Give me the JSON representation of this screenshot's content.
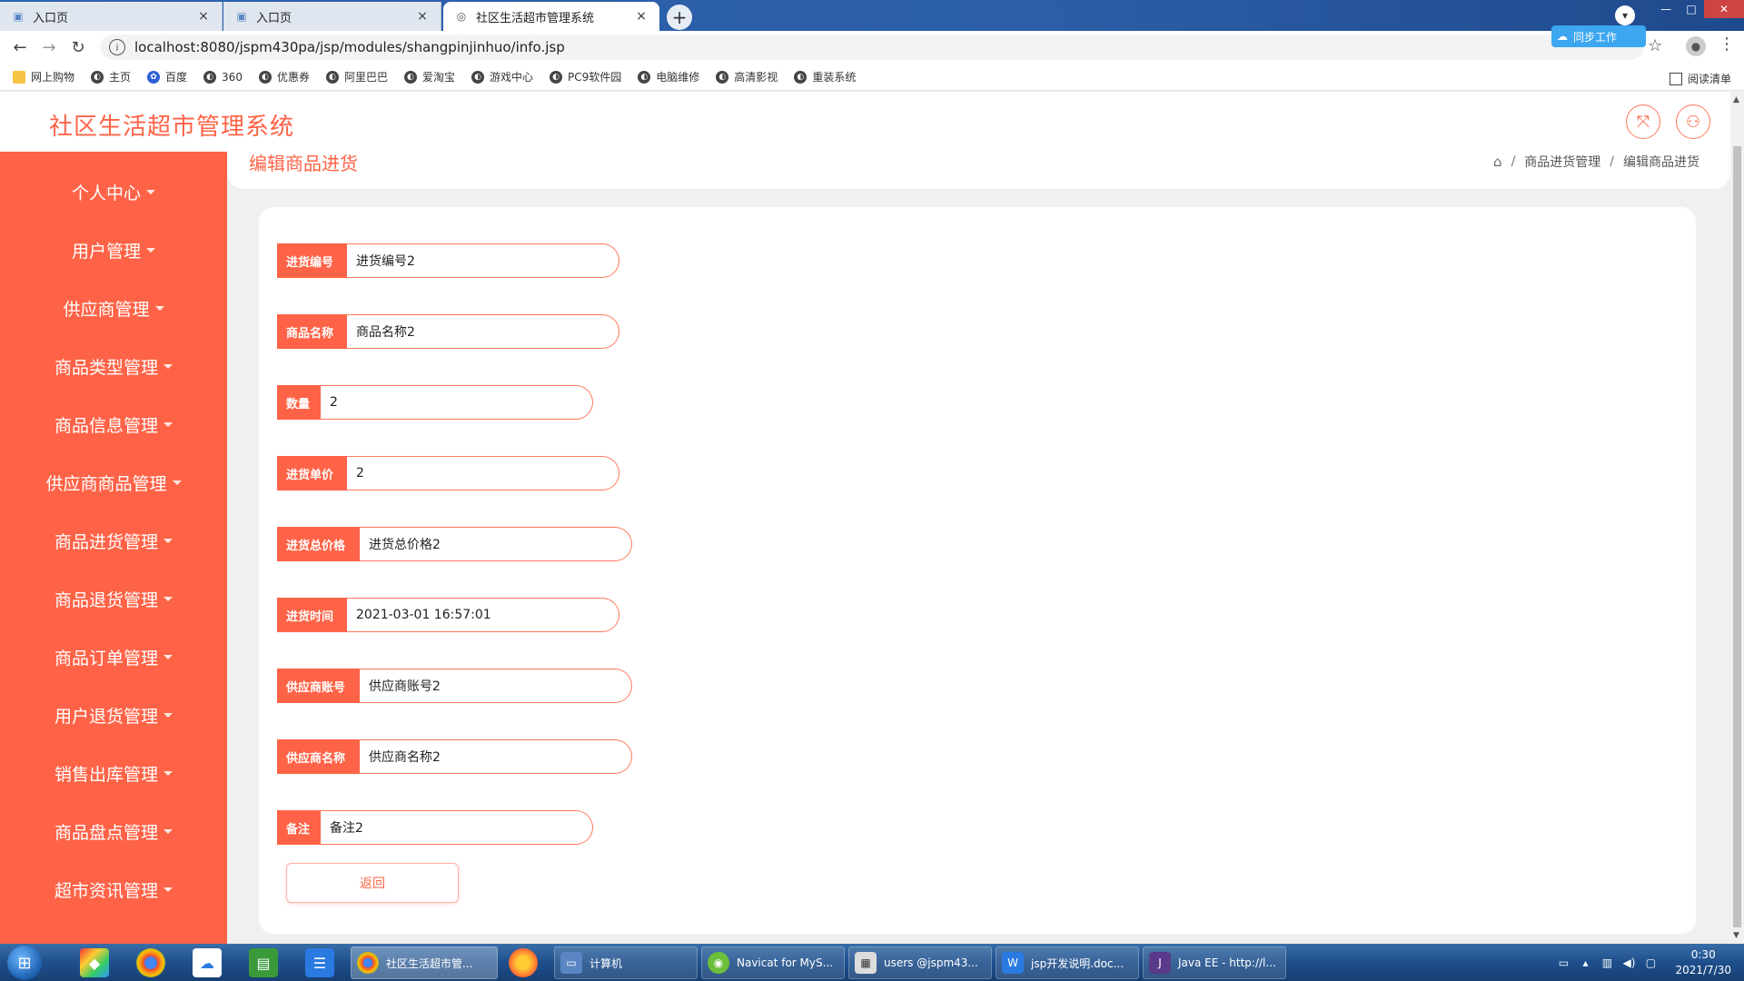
{
  "browser": {
    "tabs": [
      {
        "label": "入口页",
        "active": false
      },
      {
        "label": "入口页",
        "active": false
      },
      {
        "label": "社区生活超市管理系统",
        "active": true
      }
    ],
    "url": "localhost:8080/jspm430pa/jsp/modules/shangpinjinhuo/info.jsp",
    "cloud_badge": "同步工作",
    "bookmarks": [
      "网上购物",
      "主页",
      "百度",
      "360",
      "优惠券",
      "阿里巴巴",
      "爱淘宝",
      "游戏中心",
      "PC9软件园",
      "电脑维修",
      "高清影视",
      "重装系统"
    ],
    "reading_list": "阅读清单"
  },
  "app": {
    "title": "社区生活超市管理系统",
    "accent": "#ff6347"
  },
  "sidebar": {
    "items": [
      {
        "label": "个人中心"
      },
      {
        "label": "用户管理"
      },
      {
        "label": "供应商管理"
      },
      {
        "label": "商品类型管理"
      },
      {
        "label": "商品信息管理"
      },
      {
        "label": "供应商商品管理"
      },
      {
        "label": "商品进货管理"
      },
      {
        "label": "商品退货管理"
      },
      {
        "label": "商品订单管理"
      },
      {
        "label": "用户退货管理"
      },
      {
        "label": "销售出库管理"
      },
      {
        "label": "商品盘点管理"
      },
      {
        "label": "超市资讯管理"
      }
    ]
  },
  "page": {
    "title": "编辑商品进货",
    "breadcrumb": [
      "商品进货管理",
      "编辑商品进货"
    ]
  },
  "form": {
    "fields": [
      {
        "label": "进货编号",
        "value": "进货编号2"
      },
      {
        "label": "商品名称",
        "value": "商品名称2"
      },
      {
        "label": "数量",
        "value": "2"
      },
      {
        "label": "进货单价",
        "value": "2"
      },
      {
        "label": "进货总价格",
        "value": "进货总价格2"
      },
      {
        "label": "进货时间",
        "value": "2021-03-01 16:57:01"
      },
      {
        "label": "供应商账号",
        "value": "供应商账号2"
      },
      {
        "label": "供应商名称",
        "value": "供应商名称2"
      },
      {
        "label": "备注",
        "value": "备注2"
      }
    ],
    "back_label": "返回"
  },
  "taskbar": {
    "tasks": [
      {
        "label": "社区生活超市管...",
        "active": true
      },
      {
        "label": "计算机",
        "active": false
      },
      {
        "label": "Navicat for MyS...",
        "active": false
      },
      {
        "label": "users @jspm43...",
        "active": false
      },
      {
        "label": "jsp开发说明.doc...",
        "active": false
      },
      {
        "label": "Java EE - http://l...",
        "active": false
      }
    ],
    "time": "0:30",
    "date": "2021/7/30"
  }
}
